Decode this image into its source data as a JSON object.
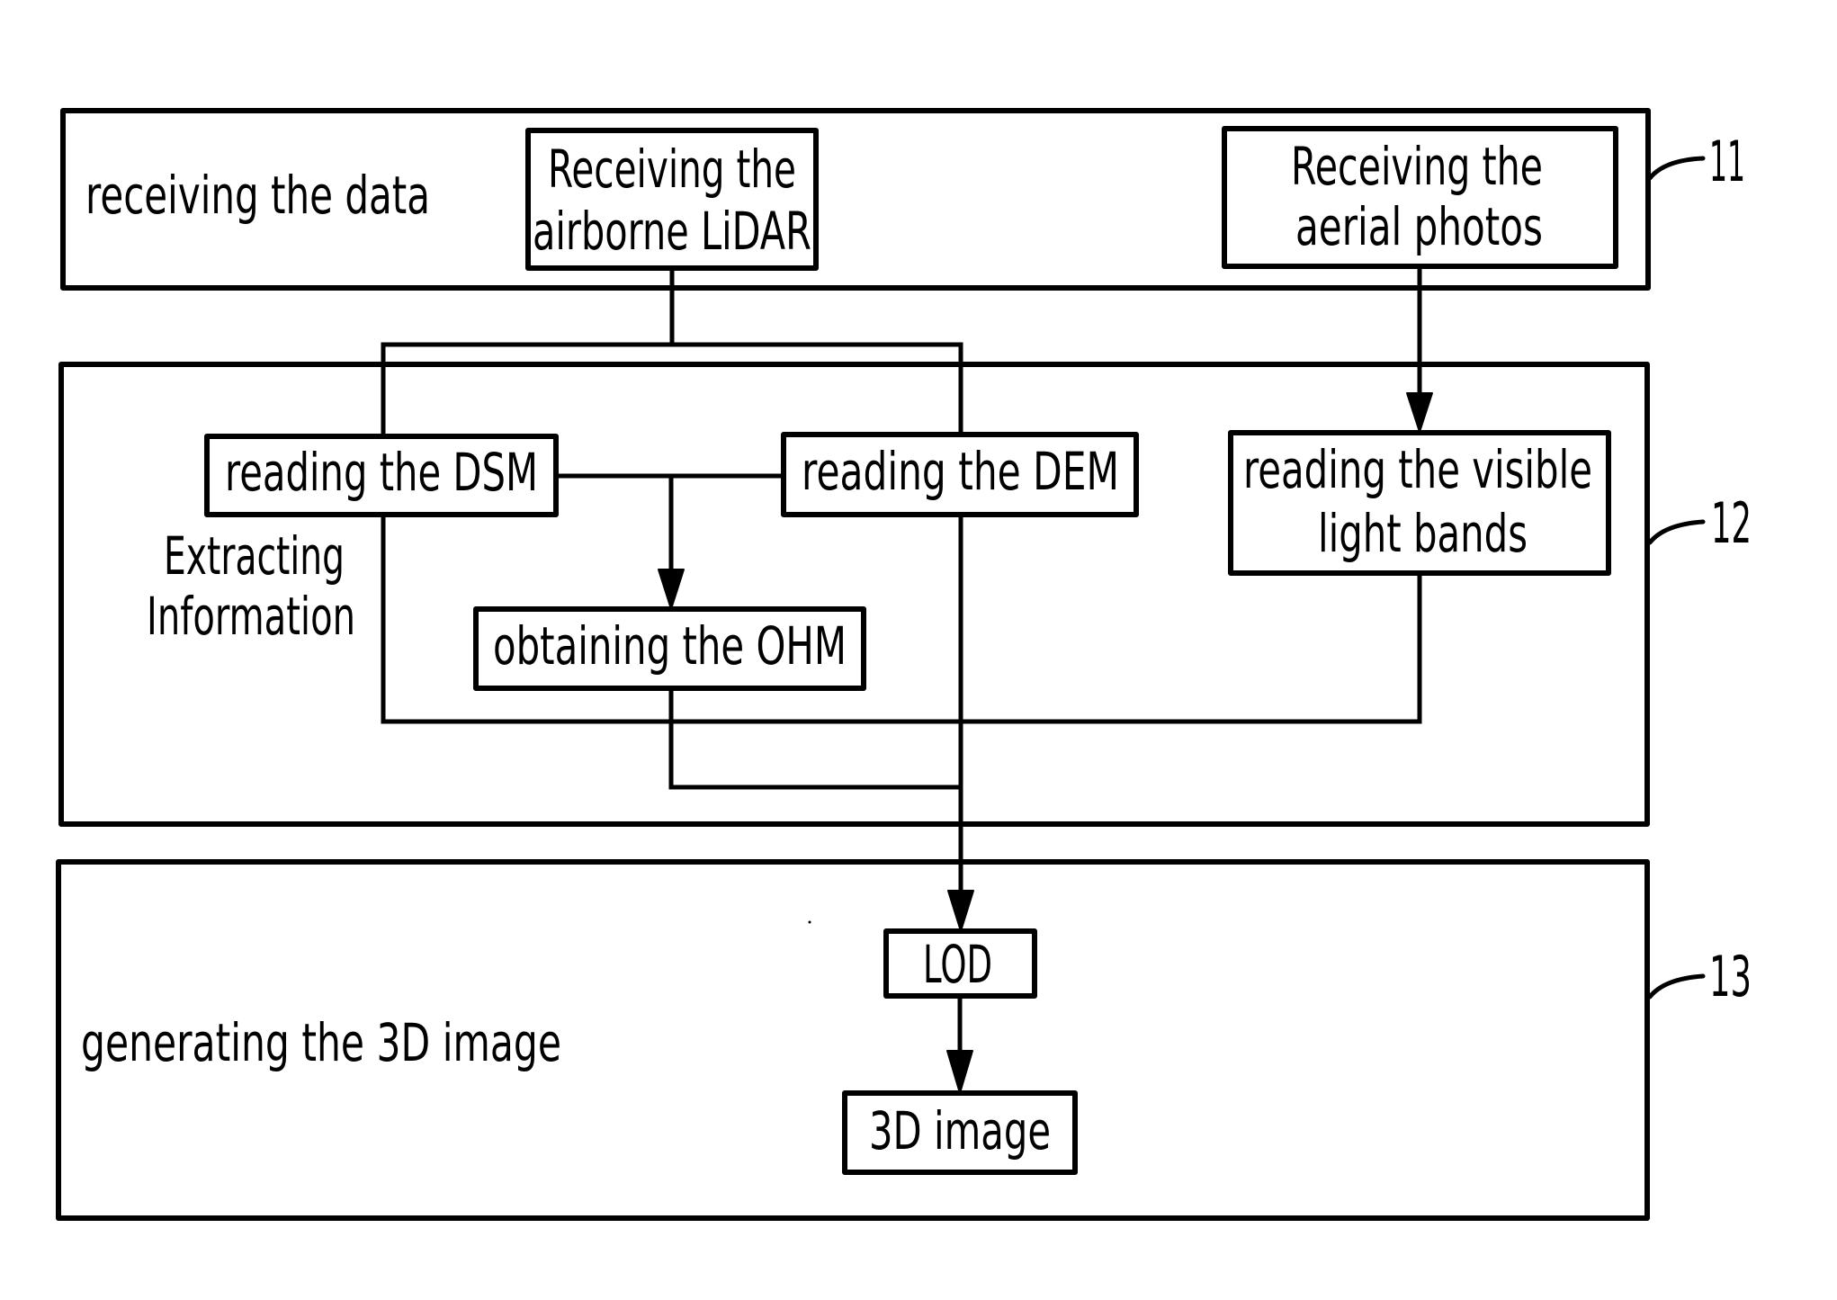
{
  "diagram": {
    "stages": [
      {
        "ref": "11",
        "label": "receiving the data"
      },
      {
        "ref": "12",
        "label_lines": [
          "Extracting",
          "Information"
        ]
      },
      {
        "ref": "13",
        "label": "generating the 3D image"
      }
    ],
    "nodes": {
      "lidar": [
        "Receiving the",
        "airborne LiDAR"
      ],
      "aerial": [
        "Receiving the",
        "aerial photos"
      ],
      "dsm": "reading the DSM",
      "dem": "reading the DEM",
      "visible": [
        "reading the visible",
        "light bands"
      ],
      "ohm": "obtaining the OHM",
      "lod": "LOD",
      "image3d": "3D image"
    },
    "edges": [
      {
        "from": "lidar",
        "to": "dsm"
      },
      {
        "from": "lidar",
        "to": "dem"
      },
      {
        "from": "aerial",
        "to": "visible"
      },
      {
        "from": "dsm",
        "to": "ohm"
      },
      {
        "from": "dem",
        "to": "ohm"
      },
      {
        "from": "dsm",
        "to": "lod"
      },
      {
        "from": "visible",
        "to": "lod"
      },
      {
        "from": "ohm",
        "to": "lod"
      },
      {
        "from": "dem",
        "to": "lod"
      },
      {
        "from": "lod",
        "to": "image3d"
      }
    ]
  }
}
